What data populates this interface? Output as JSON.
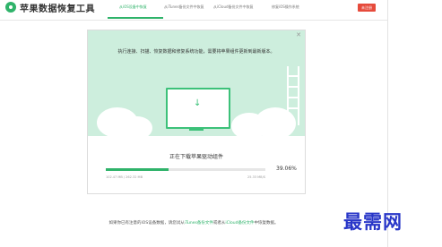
{
  "app": {
    "title": "苹果数据恢复工具",
    "register_label": "未注册"
  },
  "tabs": [
    {
      "label": "从iOS设备中恢复",
      "active": true
    },
    {
      "label": "从iTunes备份文件中恢复",
      "active": false
    },
    {
      "label": "从iCloud备份文件中恢复",
      "active": false
    },
    {
      "label": "修复iOS操作系统",
      "active": false
    }
  ],
  "dialog": {
    "message": "执行连接、扫描、恢复数据和修复系统功能，需要将苹果组件更新到最新版本。",
    "status": "正在下载苹果驱动组件",
    "progress_percent": 39.06,
    "percent_label": "39.06%",
    "size_left": "102.47 MB / 262.32 MB",
    "size_right": "25.33 MB/S"
  },
  "footer": {
    "prefix": "如果你已有注意的iOS设备数据，请您试从",
    "link1": "iTunes备份文件",
    "middle": "或者从",
    "link2": "iCloud备份文件",
    "suffix": "中恢复数据。"
  },
  "watermark": "最需网",
  "colors": {
    "accent": "#2fb36a",
    "register": "#e64b3c",
    "watermark": "#2836c8"
  }
}
